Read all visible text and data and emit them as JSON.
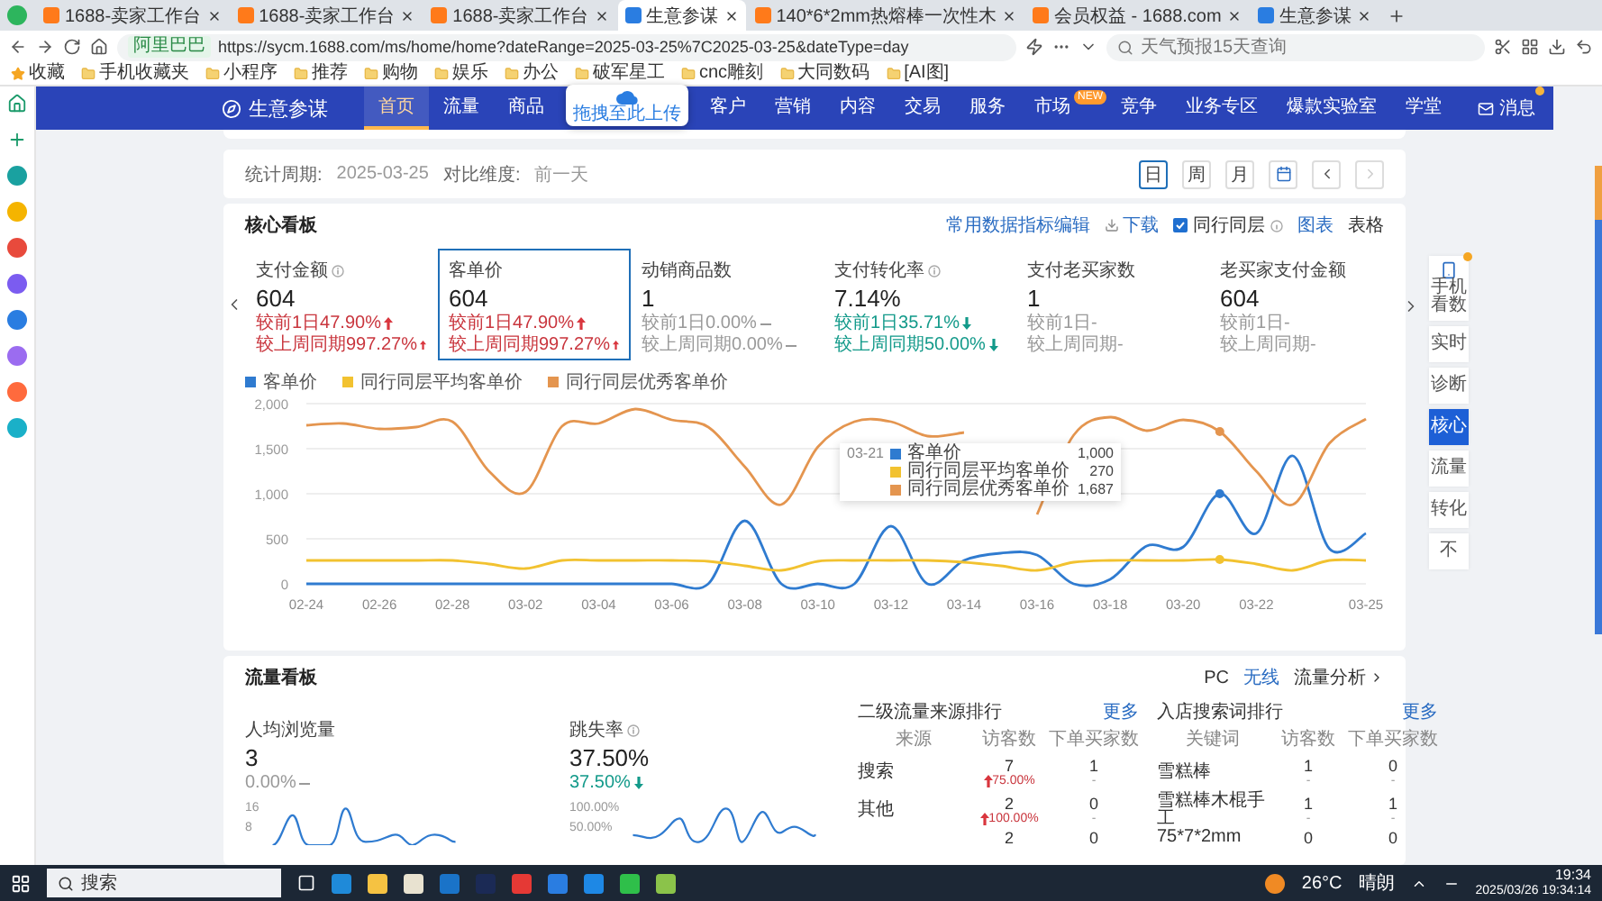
{
  "browser": {
    "tabs": [
      {
        "title": "1688-卖家工作台",
        "selected": false
      },
      {
        "title": "1688-卖家工作台",
        "selected": false
      },
      {
        "title": "1688-卖家工作台",
        "selected": false
      },
      {
        "title": "生意参谋",
        "selected": true
      },
      {
        "title": "140*6*2mm热熔棒一次性木",
        "selected": false
      },
      {
        "title": "会员权益 - 1688.com",
        "selected": false
      },
      {
        "title": "生意参谋",
        "selected": false
      }
    ],
    "site_badge": "阿里巴巴",
    "url": "https://sycm.1688.com/ms/home/home?dateRange=2025-03-25%7C2025-03-25&dateType=day",
    "search_placeholder": "天气预报15天查询",
    "bookmarks": [
      "收藏",
      "手机收藏夹",
      "小程序",
      "推荐",
      "购物",
      "娱乐",
      "办公",
      "破军星工",
      "cnc雕刻",
      "大同数码",
      "[AI图]"
    ]
  },
  "nav": {
    "logo": "生意参谋",
    "items": [
      {
        "kind": "link",
        "label": "首页",
        "selected": true
      },
      {
        "kind": "link",
        "label": "流量",
        "selected": false
      },
      {
        "kind": "link",
        "label": "商品",
        "selected": false
      },
      {
        "kind": "popup",
        "label": "拖拽至此上传"
      },
      {
        "kind": "link",
        "label": "客户",
        "selected": false
      },
      {
        "kind": "link",
        "label": "营销",
        "selected": false
      },
      {
        "kind": "link",
        "label": "内容",
        "selected": false
      },
      {
        "kind": "link",
        "label": "交易",
        "selected": false
      },
      {
        "kind": "link",
        "label": "服务",
        "selected": false
      },
      {
        "kind": "link",
        "label": "市场",
        "selected": false,
        "badge": "NEW"
      },
      {
        "kind": "link",
        "label": "竞争",
        "selected": false
      },
      {
        "kind": "link",
        "label": "业务专区",
        "selected": false
      },
      {
        "kind": "link",
        "label": "爆款实验室",
        "selected": false
      },
      {
        "kind": "link",
        "label": "学堂",
        "selected": false
      }
    ],
    "message": "消息",
    "unread": true
  },
  "date_bar": {
    "period_label": "统计周期:",
    "period": "2025-03-25",
    "compare_label": "对比维度:",
    "compare": "前一天",
    "modes": [
      {
        "label": "日",
        "selected": true
      },
      {
        "label": "周",
        "selected": false
      },
      {
        "label": "月",
        "selected": false
      }
    ]
  },
  "core": {
    "title": "核心看板",
    "links": [
      "常用数据指标编辑",
      "下载"
    ],
    "peer": {
      "label": "同行同层",
      "checked": true
    },
    "views": [
      {
        "label": "图表",
        "selected": true
      },
      {
        "label": "表格",
        "selected": false
      }
    ],
    "metrics": [
      {
        "name": "支付金额",
        "info": true,
        "value": "604",
        "selected": false,
        "lines": [
          {
            "text": "较前1日47.90%",
            "kind": "up"
          },
          {
            "text": "较上周同期997.27%",
            "kind": "up"
          }
        ]
      },
      {
        "name": "客单价",
        "info": false,
        "value": "604",
        "selected": true,
        "lines": [
          {
            "text": "较前1日47.90%",
            "kind": "up"
          },
          {
            "text": "较上周同期997.27%",
            "kind": "up"
          }
        ]
      },
      {
        "name": "动销商品数",
        "info": false,
        "value": "1",
        "selected": false,
        "lines": [
          {
            "text": "较前1日0.00%",
            "kind": "flat"
          },
          {
            "text": "较上周同期0.00%",
            "kind": "flat"
          }
        ]
      },
      {
        "name": "支付转化率",
        "info": true,
        "value": "7.14%",
        "selected": false,
        "lines": [
          {
            "text": "较前1日35.71%",
            "kind": "down"
          },
          {
            "text": "较上周同期50.00%",
            "kind": "down"
          }
        ]
      },
      {
        "name": "支付老买家数",
        "info": false,
        "value": "1",
        "selected": false,
        "lines": [
          {
            "text": "较前1日-",
            "kind": "plain"
          },
          {
            "text": "较上周同期-",
            "kind": "plain"
          }
        ]
      },
      {
        "name": "老买家支付金额",
        "info": false,
        "value": "604",
        "selected": false,
        "lines": [
          {
            "text": "较前1日-",
            "kind": "plain"
          },
          {
            "text": "较上周同期-",
            "kind": "plain"
          }
        ]
      }
    ],
    "chart_data": {
      "type": "line",
      "grid": true,
      "legend": "top-left",
      "categories": [
        "02-24",
        null,
        "02-26",
        null,
        "02-28",
        null,
        "03-02",
        null,
        "03-04",
        null,
        "03-06",
        null,
        "03-08",
        null,
        "03-10",
        null,
        "03-12",
        null,
        "03-14",
        null,
        "03-16",
        null,
        "03-18",
        null,
        "03-20",
        null,
        "03-22",
        null,
        null,
        "03-25"
      ],
      "ylim": [
        0,
        2000
      ],
      "yticks": [
        {
          "value": 0,
          "label": "0"
        },
        {
          "value": 500,
          "label": "500"
        },
        {
          "value": 1000,
          "label": "1,000"
        },
        {
          "value": 1500,
          "label": "1,500"
        },
        {
          "value": 2000,
          "label": "2,000"
        }
      ],
      "series": [
        {
          "name": "客单价",
          "color": "#2f7bd0",
          "values": [
            0,
            0,
            0,
            0,
            0,
            0,
            0,
            0,
            0,
            0,
            0,
            0,
            700,
            0,
            0,
            0,
            640,
            0,
            260,
            340,
            320,
            0,
            50,
            420,
            410,
            1000,
            560,
            1420,
            390,
            560
          ]
        },
        {
          "name": "同行同层平均客单价",
          "color": "#f2c230",
          "values": [
            260,
            260,
            260,
            260,
            260,
            220,
            170,
            260,
            260,
            260,
            260,
            250,
            200,
            150,
            250,
            260,
            260,
            260,
            240,
            200,
            150,
            240,
            260,
            260,
            260,
            270,
            220,
            150,
            260,
            260
          ]
        },
        {
          "name": "同行同层优秀客单价",
          "color": "#e4954f",
          "values": [
            1760,
            1780,
            1720,
            1740,
            1800,
            1250,
            1020,
            1750,
            1780,
            1940,
            1820,
            1740,
            1300,
            880,
            1520,
            1800,
            1800,
            1640,
            1680,
            null,
            770,
            1650,
            1850,
            1700,
            1820,
            1690,
            1250,
            880,
            1560,
            1830
          ]
        }
      ]
    },
    "tooltip": {
      "date": "03-21",
      "rows": [
        {
          "name": "客单价",
          "value": "1,000"
        },
        {
          "name": "同行同层平均客单价",
          "value": "270"
        },
        {
          "name": "同行同层优秀客单价",
          "value": "1,687"
        }
      ]
    }
  },
  "traffic": {
    "title": "流量看板",
    "devices": [
      {
        "label": "PC",
        "selected": false
      },
      {
        "label": "无线",
        "selected": true
      }
    ],
    "analysis_link": "流量分析",
    "metrics": [
      {
        "name": "人均浏览量",
        "info": false,
        "value": "3",
        "change": "0.00%",
        "kind": "flat",
        "ticks": [
          "16",
          "8"
        ]
      },
      {
        "name": "跳失率",
        "info": true,
        "value": "37.50%",
        "change": "37.50%",
        "kind": "down",
        "ticks": [
          "100.00%",
          "50.00%"
        ]
      }
    ],
    "tables": [
      {
        "title": "二级流量来源排行",
        "more": "更多",
        "columns": [
          "来源",
          "访客数",
          "下单买家数"
        ],
        "rows": [
          [
            {
              "text": "搜索"
            },
            {
              "text": "7",
              "sub": "75.00%",
              "kind": "up"
            },
            {
              "text": "1",
              "sub": "-",
              "kind": "plain"
            }
          ],
          [
            {
              "text": "其他"
            },
            {
              "text": "2",
              "sub": "100.00%",
              "kind": "up"
            },
            {
              "text": "0",
              "sub": "-",
              "kind": "plain"
            }
          ],
          [
            {
              "text": ""
            },
            {
              "text": "2"
            },
            {
              "text": "0"
            }
          ]
        ]
      },
      {
        "title": "入店搜索词排行",
        "more": "更多",
        "columns": [
          "关键词",
          "访客数",
          "下单买家数"
        ],
        "rows": [
          [
            {
              "text": "雪糕棒"
            },
            {
              "text": "1",
              "sub": "-",
              "kind": "plain"
            },
            {
              "text": "0",
              "sub": "-",
              "kind": "plain"
            }
          ],
          [
            {
              "text": "雪糕棒木棍手工"
            },
            {
              "text": "1",
              "sub": "-",
              "kind": "plain"
            },
            {
              "text": "1",
              "sub": "-",
              "kind": "plain"
            }
          ],
          [
            {
              "text": "75*7*2mm"
            },
            {
              "text": "0"
            },
            {
              "text": "0"
            }
          ]
        ]
      }
    ]
  },
  "side_tabs": [
    {
      "kind": "mobile",
      "label": "手机看数",
      "selected": false,
      "badge": true
    },
    {
      "kind": "text",
      "label": "实时",
      "selected": false
    },
    {
      "kind": "text",
      "label": "诊断",
      "selected": false
    },
    {
      "kind": "text",
      "label": "核心",
      "selected": true
    },
    {
      "kind": "text",
      "label": "流量",
      "selected": false
    },
    {
      "kind": "text",
      "label": "转化",
      "selected": false
    },
    {
      "kind": "text",
      "label": "不",
      "selected": false
    }
  ],
  "taskbar": {
    "search_placeholder": "搜索",
    "weather": "26°C",
    "condition": "晴朗",
    "time": "19:34",
    "date": "2025/03/26 19:34:14"
  }
}
